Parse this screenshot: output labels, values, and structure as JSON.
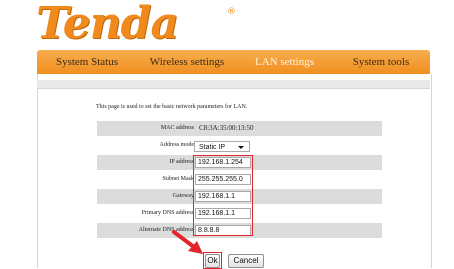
{
  "brand": {
    "logo_text": "Tenda",
    "logo_mark": "®",
    "color": "#f08a1c"
  },
  "nav": {
    "tabs": [
      {
        "label": "System Status",
        "active": false
      },
      {
        "label": "Wireless settings",
        "active": false
      },
      {
        "label": "LAN settings",
        "active": true
      },
      {
        "label": "System tools",
        "active": false
      }
    ]
  },
  "page": {
    "intro": "This page is used to set the basic network parameters for LAN.",
    "mac": {
      "label": "MAC address",
      "value": "C8:3A:35:00:13:50"
    },
    "mode": {
      "label": "Address mode",
      "value": "Static IP"
    },
    "ip": {
      "label": "IP address",
      "value": "192.168.1.254"
    },
    "mask": {
      "label": "Subnet Mask",
      "value": "255.255.255.0"
    },
    "gateway": {
      "label": "Gateway",
      "value": "192.168.1.1"
    },
    "dns1": {
      "label": "Primary DNS address",
      "value": "192.168.1.1"
    },
    "dns2": {
      "label": "Alternate DNS address",
      "value": "8.8.8.8"
    }
  },
  "buttons": {
    "ok": "Ok",
    "cancel": "Cancel"
  },
  "colors": {
    "nav": "#f29321",
    "highlight": "#e0252b"
  }
}
